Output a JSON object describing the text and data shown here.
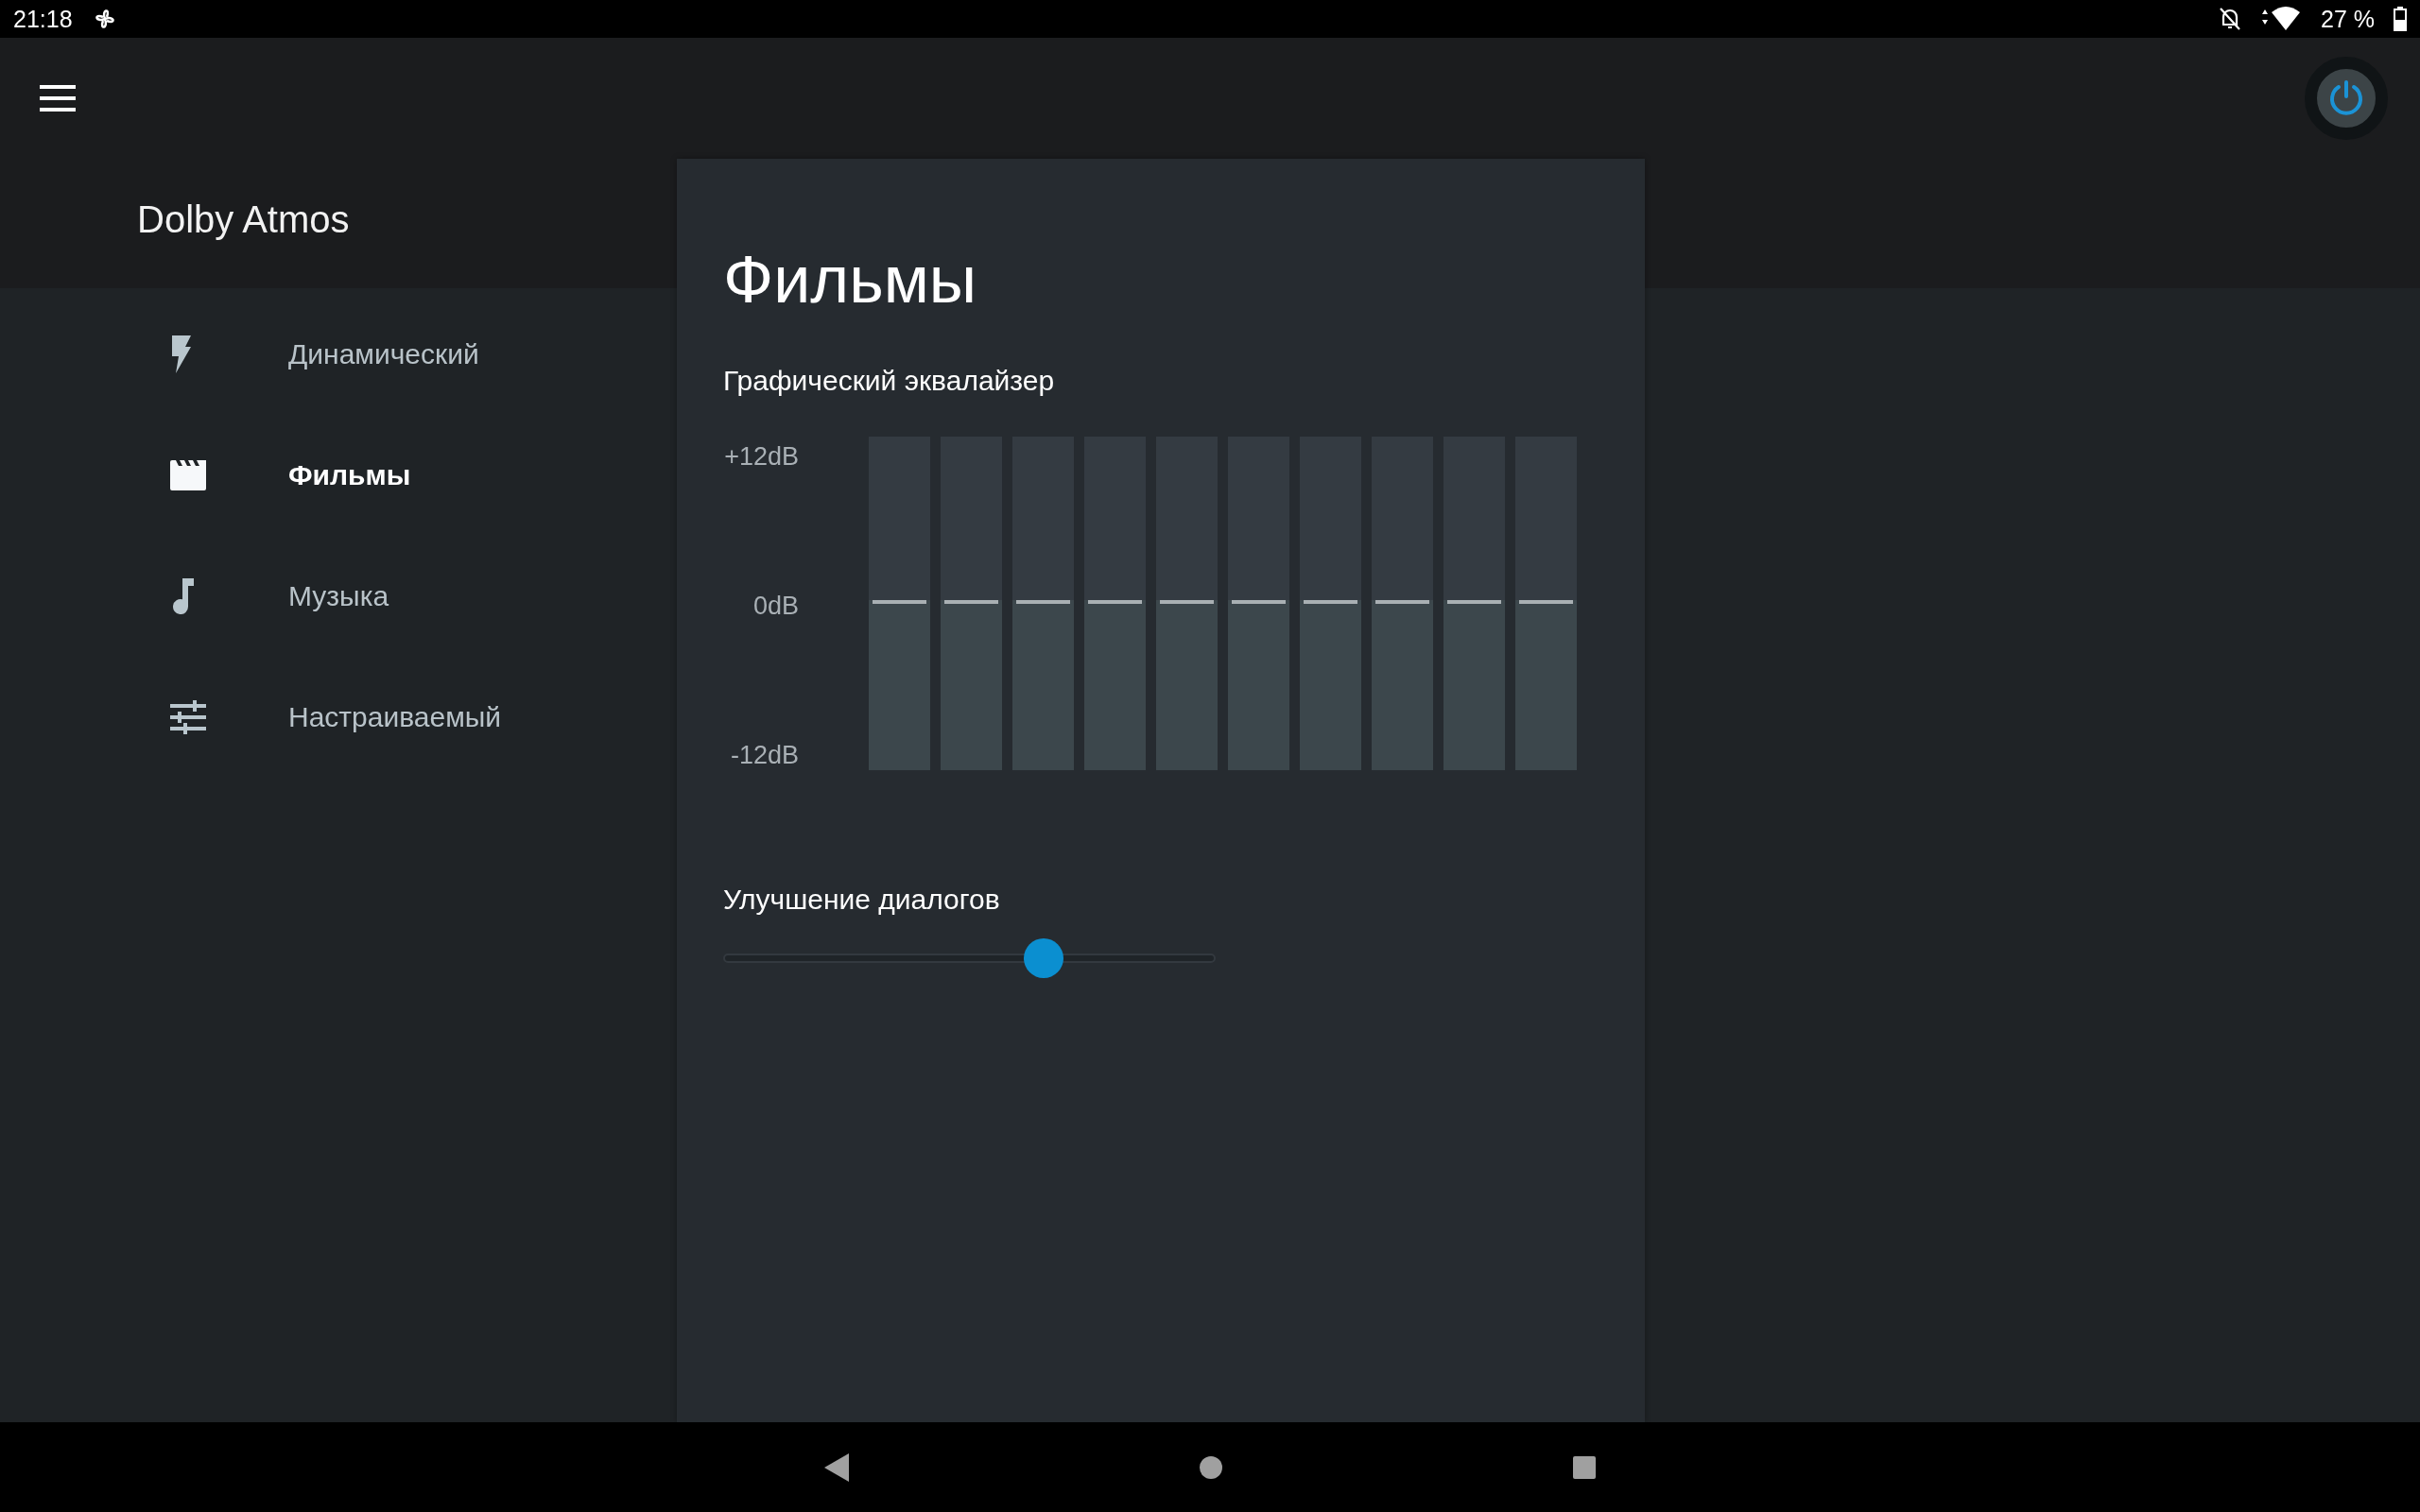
{
  "status_bar": {
    "time": "21:18",
    "battery": "27 %"
  },
  "app_bar": {
    "title": "Dolby Atmos"
  },
  "power": {
    "on": true
  },
  "profiles": [
    {
      "label": "Динамический",
      "kind": "dynamic",
      "selected": false
    },
    {
      "label": "Фильмы",
      "kind": "movie",
      "selected": true
    },
    {
      "label": "Музыка",
      "kind": "music",
      "selected": false
    },
    {
      "label": "Настраиваемый",
      "kind": "custom",
      "selected": false
    }
  ],
  "panel": {
    "title": "Фильмы",
    "equalizer": {
      "title": "Графический эквалайзер",
      "scale": [
        "+12dB",
        "0dB",
        "-12dB"
      ],
      "bands": [
        {
          "level": 0.5
        },
        {
          "level": 0.5
        },
        {
          "level": 0.5
        },
        {
          "level": 0.5
        },
        {
          "level": 0.5
        },
        {
          "level": 0.5
        },
        {
          "level": 0.5
        },
        {
          "level": 0.5
        },
        {
          "level": 0.5
        },
        {
          "level": 0.5
        }
      ]
    },
    "dialogue": {
      "title": "Улучшение диалогов",
      "level": 0.65
    }
  }
}
